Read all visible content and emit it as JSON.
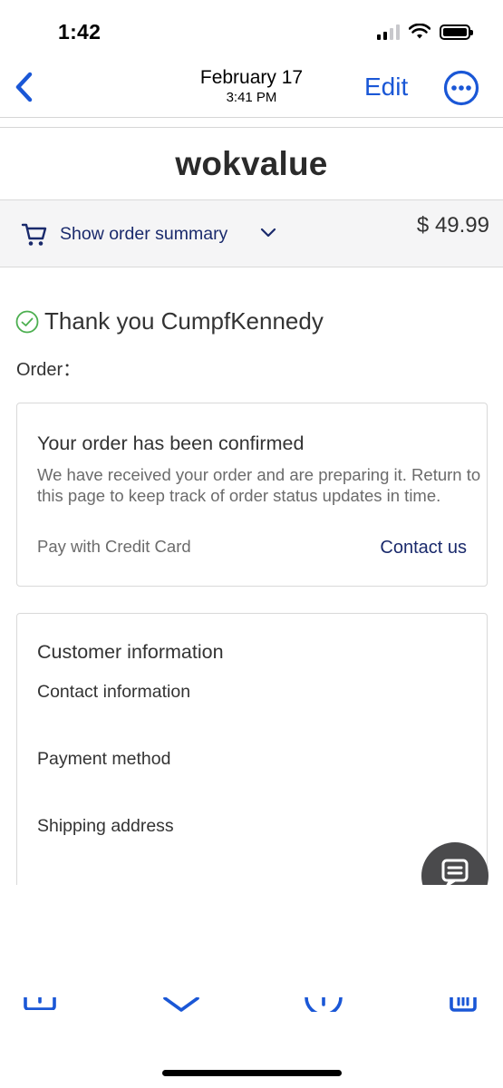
{
  "status_bar": {
    "time": "1:42"
  },
  "nav": {
    "date": "February 17",
    "time": "3:41 PM",
    "edit_label": "Edit"
  },
  "store": {
    "brand": "wokvalue"
  },
  "order_summary": {
    "toggle_label": "Show order summary",
    "total": "$ 49.99"
  },
  "confirmation": {
    "thank_you": "Thank you CumpfKennedy",
    "order_label": "Order："
  },
  "status_card": {
    "title": "Your order has been confirmed",
    "message": "We have received your order and are preparing it. Return to this page to keep track of order status updates in time.",
    "payment": "Pay with Credit Card",
    "contact_label": "Contact us"
  },
  "customer_card": {
    "title": "Customer information",
    "contact_heading": "Contact information",
    "payment_heading": "Payment method",
    "shipping_heading": "Shipping address"
  },
  "colors": {
    "ios_blue": "#1a57d6",
    "store_navy": "#1a2a6c",
    "success_green": "#4caf50"
  },
  "icons": {
    "back": "chevron-left-icon",
    "more": "ellipsis-circle-icon",
    "cart": "cart-icon",
    "expand": "chevron-down-icon",
    "check": "check-circle-icon",
    "chat": "chat-icon",
    "share": "share-icon",
    "next": "chevron-down-icon",
    "reply": "reply-icon",
    "archive": "archive-icon"
  }
}
